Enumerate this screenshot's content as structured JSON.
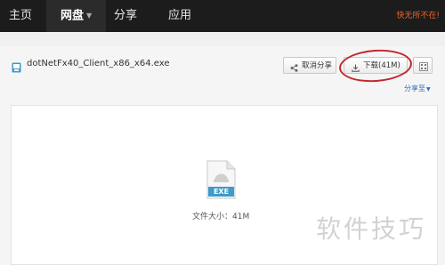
{
  "nav": {
    "items": [
      {
        "label": "主页"
      },
      {
        "label": "网盘",
        "active": true
      },
      {
        "label": "分享"
      },
      {
        "label": "应用"
      }
    ],
    "slogan": "快无所不在!"
  },
  "file": {
    "name": "dotNetFx40_Client_x86_x64.exe",
    "icon": "exe-file-icon"
  },
  "actions": {
    "cancel_share_label": "取消分享",
    "download_label": "下载(41M)",
    "qr_icon": "qr-code-icon",
    "share_to_label": "分享至"
  },
  "preview": {
    "badge": "EXE",
    "size_label": "文件大小：41M"
  },
  "watermark": "软件技巧",
  "colors": {
    "nav_bg": "#1c1c1c",
    "slogan": "#f0642c",
    "link": "#2d6fb7",
    "highlight_circle": "#c1272d",
    "exe_badge": "#3d9cc8"
  }
}
